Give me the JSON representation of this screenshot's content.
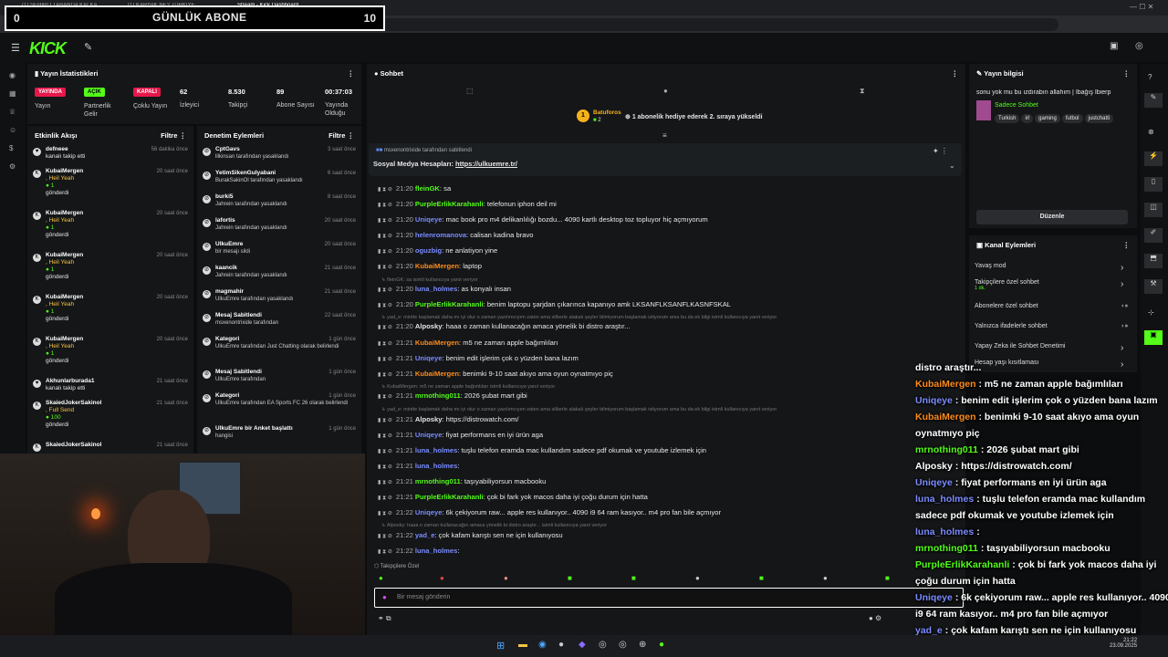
{
  "browser": {
    "tabs": [
      "(1) ŞEHİRLİ TABANDA KALKA...",
      "(1) KARIŞIK NE? TÜRKİYE...",
      "Stream - Kick Dashboard"
    ],
    "url": "https://dashboard.kick.com/stream"
  },
  "overlay": {
    "left_num": "0",
    "title": "GÜNLÜK ABONE",
    "right_num": "10"
  },
  "header": {
    "logo": "KICK"
  },
  "stats": {
    "title": "Yayın İstatistikleri",
    "items": [
      {
        "value": "YAYINDA",
        "label": "Yayın",
        "badge": true,
        "color": "#e8174a"
      },
      {
        "value": "AÇIK",
        "label": "Partnerlik Gelir",
        "badge": true,
        "color": "#53fc18"
      },
      {
        "value": "KAPALI",
        "label": "Çoklu Yayın",
        "badge": true,
        "color": "#e8174a"
      },
      {
        "value": "62",
        "label": "İzleyici"
      },
      {
        "value": "8.530",
        "label": "Takipçi"
      },
      {
        "value": "89",
        "label": "Abone Sayısı"
      },
      {
        "value": "00:37:03",
        "label": "Yayında Olduğu"
      }
    ]
  },
  "activity": {
    "title": "Etkinlik Akışı",
    "filter": "Filtre",
    "items": [
      {
        "name": "defneee",
        "desc": "kanalı takip etti",
        "time": "56 dakika önce",
        "icon": "heart-icon"
      },
      {
        "name": "KubaiMergen",
        "desc": ", Heil Yeah",
        "extra": "1",
        "sent": "gönderdi",
        "time": "20 saat önce",
        "icon": "kick-icon"
      },
      {
        "name": "KubaiMergen",
        "desc": ", Heil Yeah",
        "extra": "1",
        "sent": "gönderdi",
        "time": "20 saat önce",
        "icon": "kick-icon"
      },
      {
        "name": "KubaiMergen",
        "desc": ", Heil Yeah",
        "extra": "1",
        "sent": "gönderdi",
        "time": "20 saat önce",
        "icon": "kick-icon"
      },
      {
        "name": "KubaiMergen",
        "desc": ", Heil Yeah",
        "extra": "1",
        "sent": "gönderdi",
        "time": "20 saat önce",
        "icon": "kick-icon"
      },
      {
        "name": "KubaiMergen",
        "desc": ", Heil Yeah",
        "extra": "1",
        "sent": "gönderdi",
        "time": "20 saat önce",
        "icon": "kick-icon"
      },
      {
        "name": "Akhunlarburada1",
        "desc": "kanalı takip etti",
        "time": "21 saat önce",
        "icon": "heart-icon"
      },
      {
        "name": "SkaiedJokerSakinol",
        "desc": ", Full Send",
        "extra": "100",
        "sent": "gönderdi",
        "time": "21 saat önce",
        "icon": "kick-icon"
      },
      {
        "name": "SkaiedJokerSakinol",
        "desc": "",
        "time": "21 saat önce",
        "icon": "kick-icon"
      }
    ]
  },
  "moderation": {
    "title": "Denetim Eylemleri",
    "filter": "Filtre",
    "items": [
      {
        "name": "CptGavs",
        "desc": "lilkinsan tarafından yasaklandı",
        "time": "3 saat önce"
      },
      {
        "name": "YetimSikenGulyabani",
        "desc": "BurakSakinOl tarafından yasaklandı",
        "time": "6 saat önce"
      },
      {
        "name": "burki5",
        "desc": "Jahrein tarafından yasaklandı",
        "time": "8 saat önce"
      },
      {
        "name": "lafortis",
        "desc": "Jahrein tarafından yasaklandı",
        "time": "20 saat önce"
      },
      {
        "name": "UlkuEmre",
        "desc": "bir mesajı sildi",
        "time": "20 saat önce"
      },
      {
        "name": "kaancik",
        "desc": "Jahrein tarafından yasaklandı",
        "time": "21 saat önce"
      },
      {
        "name": "magmahir",
        "desc": "UlkuEmre tarafından yasaklandı",
        "time": "21 saat önce"
      },
      {
        "name": "Mesaj Sabitlendi",
        "desc": "msxenontrixide tarafından",
        "time": "22 saat önce"
      },
      {
        "name": "Kategori",
        "desc": "UlkuEmre tarafından Just Chatting olarak belirlendi",
        "time": "1 gün önce"
      },
      {
        "name": "Mesaj Sabitlendi",
        "desc": "UlkuEmre tarafından",
        "time": "1 gün önce"
      },
      {
        "name": "Kategori",
        "desc": "UlkuEmre tarafından EA Sports FC 26 olarak belirlendi",
        "time": "1 gün önce"
      },
      {
        "name": "UlkuEmre bir Anket başlattı",
        "desc": "hangisi",
        "time": "1 gün önce"
      }
    ]
  },
  "chat": {
    "title": "Sohbet",
    "hype_user": "Batuforos",
    "hype_count": "2",
    "hype_text": "1 abonelik hediye ederek 2. sıraya yükseldi",
    "pinned_by": "msxenontrixide tarafından sabitlendi",
    "pinned_text": "Sosyal Medya Hesapları: ",
    "pinned_link": "https://ulkuemre.tr/",
    "messages": [
      {
        "ts": "21:20",
        "user": "fleinGK",
        "text": ": sa",
        "color": "#53fc18"
      },
      {
        "ts": "21:20",
        "user": "PurpleErlikKarahanli",
        "text": ": telefonun iphon deil mi",
        "color": "#53fc18"
      },
      {
        "ts": "21:20",
        "user": "Uniqeye",
        "text": ": mac book pro m4 delikanlılığı bozdu... 4090 kartlı desktop toz topluyor hiç açmıyorum",
        "color": "#7b8cff"
      },
      {
        "ts": "21:20",
        "user": "helenromanova",
        "text": ": calisan kadina bravo",
        "color": "#7b8cff"
      },
      {
        "ts": "21:20",
        "user": "oguzbig",
        "text": ": ne anlatiyon yine",
        "color": "#7b8cff"
      },
      {
        "ts": "21:20",
        "user": "KubaiMergen",
        "text": ": laptop",
        "color": "#ff8c1a"
      },
      {
        "ts": "21:20",
        "user": "luna_holmes",
        "text": ": as konyalı insan",
        "color": "#7b8cff"
      },
      {
        "ts": "21:20",
        "user": "PurpleErlikKarahanli",
        "text": ": benim laptopu şarjdan çıkarınca kapanıyo amk LKSANFLKSANFLKASNFSKAL",
        "color": "#53fc18"
      },
      {
        "ts": "21:20",
        "user": "Alposky",
        "text": ": haaa o zaman kullanacağın amaca yönelik bi distro araştır...",
        "color": "#e8e8e8"
      },
      {
        "ts": "21:21",
        "user": "KubaiMergen",
        "text": ": m5 ne zaman apple bağımlıları",
        "color": "#ff8c1a"
      },
      {
        "ts": "21:21",
        "user": "Uniqeye",
        "text": ": benim edit işlerim çok o yüzden bana lazım",
        "color": "#7b8cff"
      },
      {
        "ts": "21:21",
        "user": "KubaiMergen",
        "text": ": benimki 9-10 saat akıyo ama oyun oynatmıyo piç",
        "color": "#ff8c1a"
      },
      {
        "ts": "21:21",
        "user": "mrnothing011",
        "text": ": 2026 şubat mart gibi",
        "color": "#53fc18"
      },
      {
        "ts": "21:21",
        "user": "Alposky",
        "text": ": https://distrowatch.com/",
        "color": "#e8e8e8"
      },
      {
        "ts": "21:21",
        "user": "Uniqeye",
        "text": ": fiyat performans en iyi ürün aga",
        "color": "#7b8cff"
      },
      {
        "ts": "21:21",
        "user": "luna_holmes",
        "text": ": tuşlu telefon eramda mac kullandım sadece pdf okumak ve youtube izlemek için",
        "color": "#7b8cff"
      },
      {
        "ts": "21:21",
        "user": "luna_holmes",
        "text": ":",
        "color": "#7b8cff"
      },
      {
        "ts": "21:21",
        "user": "mrnothing011",
        "text": ": taşıyabiliyorsun macbooku",
        "color": "#53fc18"
      },
      {
        "ts": "21:21",
        "user": "PurpleErlikKarahanli",
        "text": ": çok bi fark yok macos daha iyi çoğu durum için hatta",
        "color": "#53fc18"
      },
      {
        "ts": "21:22",
        "user": "Uniqeye",
        "text": ": 6k çekiyorum raw... apple res kullanıyor.. 4090 i9 64 ram kasıyor.. m4 pro fan bile açmıyor",
        "color": "#7b8cff"
      },
      {
        "ts": "21:22",
        "user": "yad_e",
        "text": ": çok kafam karıştı sen ne için kullanıyosu",
        "color": "#7b8cff"
      },
      {
        "ts": "21:22",
        "user": "luna_holmes",
        "text": ":",
        "color": "#7b8cff"
      }
    ],
    "sys_notes": [
      "fleinGK: sa isimli kullanıcıya yanıt veriyor",
      "yad_e: mintte başlamak daha mı iyi olur o zaman yazılımcıyım zaten ama silberle alakalı şeyler bilmiyorum başlamak istiyorum ama bu da ek bilgi isimli kullanıcıya yanıt veriyor",
      "KubaiMergen: m5 ne zaman apple bağımlıları isimli kullanıcıya yanıt veriyor",
      "yad_e: mintte başlamak daha mı iyi olur o zaman yazılımcıyım zaten ama silberle alakalı şeyler bilmiyorum başlamak istiyorum ama bu da ek bilgi isimli kullanıcıya yanıt veriyor",
      "Alposky: haaa o zaman kullanacağın amaca yönelik bi distro araştır... isimli kullanıcıya yanıt veriyor"
    ],
    "followers_only": "Takipçilere Özel",
    "input_placeholder": "Bir mesaj gönderin"
  },
  "stream_info": {
    "title": "Yayın bilgisi",
    "stream_title": "sonu yok mu bu ızdırabın allahım | İbağış Ibierp",
    "category": "Sadece Sohbet",
    "tags": [
      "Turkish",
      "irl",
      "gaming",
      "futbol",
      "justchatti"
    ],
    "edit_button": "Düzenle"
  },
  "channel_actions": {
    "title": "Kanal Eylemleri",
    "items": [
      "Yavaş mod",
      "Takipçilere özel sohbet",
      "Abonelere özel sohbet",
      "Yalnızca ifadelerle sohbet",
      "Yapay Zeka ile Sohbet Denetimi",
      "Hesap yaşı kısıtlaması"
    ],
    "sub": "1 dk."
  },
  "overlay_chat": [
    {
      "user": "",
      "text": "distro araştır...",
      "color": "#fff"
    },
    {
      "user": "KubaiMergen",
      "text": ": m5 ne zaman apple bağımlıları",
      "color": "#ff8c1a"
    },
    {
      "user": "Uniqeye",
      "text": ": benim edit işlerim çok o yüzden bana lazım",
      "color": "#7b8cff"
    },
    {
      "user": "KubaiMergen",
      "text": ": benimki 9-10 saat akıyo ama oyun",
      "color": "#ff8c1a"
    },
    {
      "user": "",
      "text": "oynatmıyo piç",
      "color": "#fff"
    },
    {
      "user": "mrnothing011",
      "text": ": 2026 şubat mart gibi",
      "color": "#53fc18"
    },
    {
      "user": "Alposky",
      "text": ": https://distrowatch.com/",
      "color": "#fff"
    },
    {
      "user": "Uniqeye",
      "text": ": fiyat performans en iyi ürün aga",
      "color": "#7b8cff"
    },
    {
      "user": "luna_holmes",
      "text": ": tuşlu telefon eramda mac kullandım",
      "color": "#7b8cff"
    },
    {
      "user": "",
      "text": "sadece pdf okumak ve youtube izlemek için",
      "color": "#fff"
    },
    {
      "user": "luna_holmes",
      "text": ":",
      "color": "#7b8cff"
    },
    {
      "user": "mrnothing011",
      "text": ": taşıyabiliyorsun macbooku",
      "color": "#53fc18"
    },
    {
      "user": "PurpleErlikKarahanli",
      "text": ": çok bi fark yok macos daha iyi",
      "color": "#53fc18"
    },
    {
      "user": "",
      "text": "çoğu durum için hatta",
      "color": "#fff"
    },
    {
      "user": "Uniqeye",
      "text": ": 6k çekiyorum raw... apple res kullanıyor.. 4090",
      "color": "#7b8cff"
    },
    {
      "user": "",
      "text": "i9 64 ram kasıyor.. m4 pro fan bile açmıyor",
      "color": "#fff"
    },
    {
      "user": "yad_e",
      "text": ": çok kafam karıştı sen ne için kullanıyosu",
      "color": "#7b8cff"
    },
    {
      "user": "luna_holmes",
      "text": ":",
      "color": "#7b8cff"
    }
  ],
  "taskbar": {
    "time": "21:22",
    "date": "23.09.2025"
  },
  "colors": {
    "accent": "#53fc18",
    "live": "#e8174a",
    "bg": "#0b0d0e",
    "panel": "#141618"
  }
}
